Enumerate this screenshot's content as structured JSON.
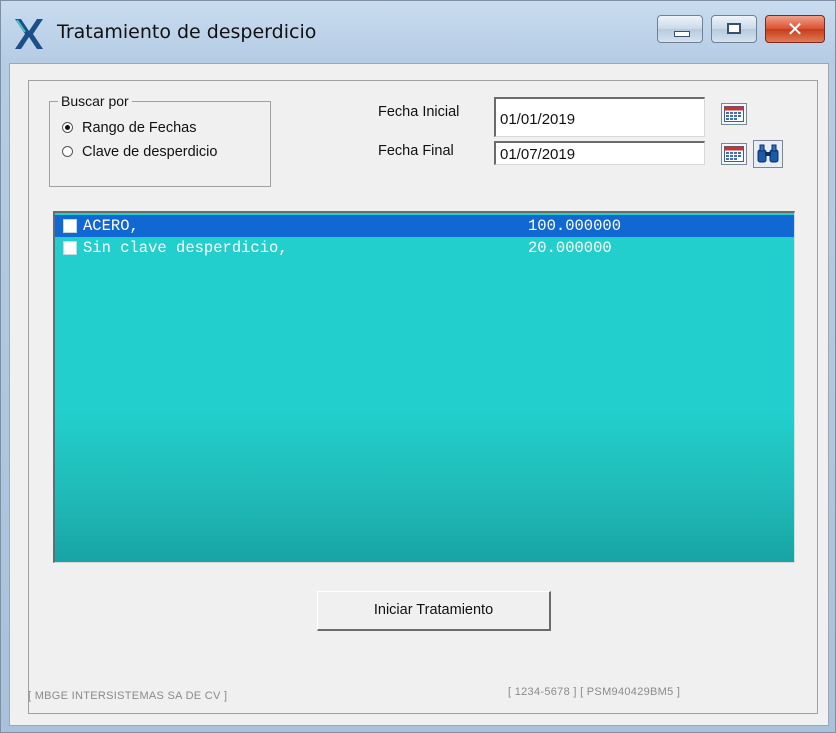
{
  "window": {
    "title": "Tratamiento de desperdicio",
    "icon": "app-logo-icon",
    "controls": [
      "minimize-icon",
      "maximize-icon",
      "close-icon"
    ]
  },
  "search": {
    "group_title": "Buscar por",
    "options": [
      {
        "label": "Rango de Fechas",
        "selected": true
      },
      {
        "label": "Clave de desperdicio",
        "selected": false
      }
    ],
    "fecha_inicial_label": "Fecha Inicial",
    "fecha_inicial_value": "01/01/2019",
    "fecha_final_label": "Fecha Final",
    "fecha_final_value": "01/07/2019",
    "calendar_icon": "calendar-icon",
    "find_icon": "binoculars-icon"
  },
  "list": {
    "items": [
      {
        "name": "ACERO,",
        "value": "100.000000",
        "selected": true,
        "checked": false
      },
      {
        "name": "Sin clave desperdicio,",
        "value": "20.000000",
        "selected": false,
        "checked": false
      }
    ],
    "colors": {
      "background": "#22cfcc",
      "selection": "#1268d2"
    }
  },
  "actions": {
    "start_label": "Iniciar Tratamiento"
  },
  "status": {
    "company": "[ MBGE INTERSISTEMAS SA DE CV ]",
    "info": "[ 1234-5678 ]  [ PSM940429BM5 ]"
  }
}
